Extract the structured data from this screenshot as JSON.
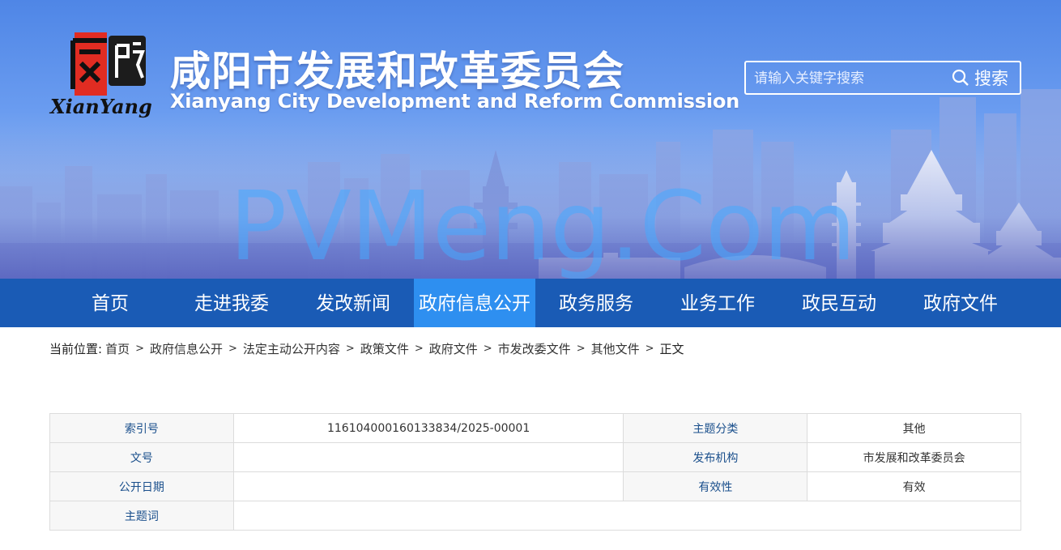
{
  "header": {
    "logo": {
      "mark_text": "咸陽",
      "wordmark": "XianYang"
    },
    "title_cn": "咸阳市发展和改革委员会",
    "title_en": "Xianyang City Development and Reform Commission",
    "watermark": "PVMeng.Com",
    "search": {
      "placeholder": "请输入关键字搜索",
      "button_label": "搜索",
      "icon": "search-icon"
    }
  },
  "colors": {
    "nav_bg": "#1a5bb5",
    "nav_active": "#2e8ff0",
    "key_text": "#1a4f8c"
  },
  "nav": {
    "items": [
      {
        "label": "首页"
      },
      {
        "label": "走进我委"
      },
      {
        "label": "发改新闻"
      },
      {
        "label": "政府信息公开",
        "active": true
      },
      {
        "label": "政务服务"
      },
      {
        "label": "业务工作"
      },
      {
        "label": "政民互动"
      },
      {
        "label": "政府文件"
      }
    ]
  },
  "breadcrumb": {
    "lead": "当前位置:",
    "items": [
      "首页",
      "政府信息公开",
      "法定主动公开内容",
      "政策文件",
      "政府文件",
      "市发改委文件",
      "其他文件"
    ],
    "current": "正文",
    "separator": ">"
  },
  "info_table": {
    "rows": [
      {
        "k1": "索引号",
        "v1": "116104000160133834/2025-00001",
        "k2": "主题分类",
        "v2": "其他"
      },
      {
        "k1": "文号",
        "v1": "",
        "k2": "发布机构",
        "v2": "市发展和改革委员会"
      },
      {
        "k1": "公开日期",
        "v1": "",
        "k2": "有效性",
        "v2": "有效"
      },
      {
        "k1": "主题词",
        "v1": ""
      }
    ]
  }
}
